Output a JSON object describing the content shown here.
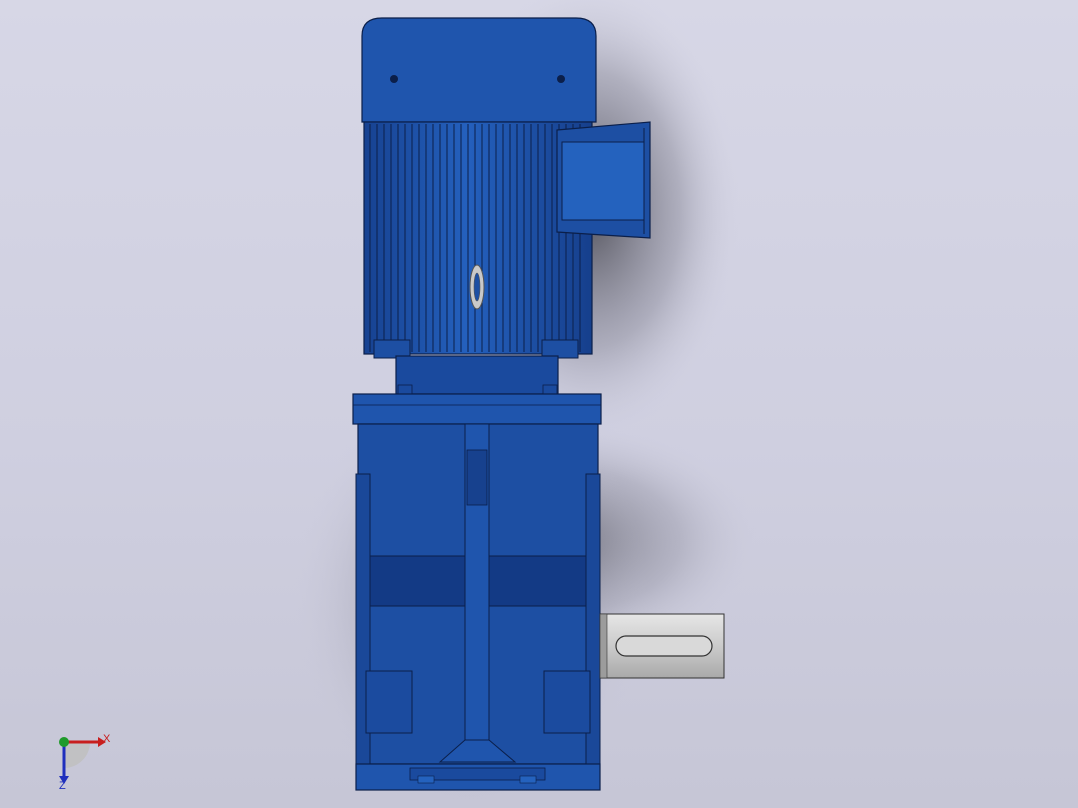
{
  "viewport": {
    "background_top": "#d7d7e6",
    "background_bottom": "#c6c6d6"
  },
  "model": {
    "body_color": "#1d4fa3",
    "body_dark": "#12357a",
    "body_light": "#2a63bd",
    "outline_color": "#0b1f4a",
    "shaft_color": "#d2d2d2"
  },
  "triad": {
    "x_label": "X",
    "z_label": "Z",
    "x_color": "#c81e1e",
    "y_color": "#1f9a2a",
    "z_color": "#1f2fbd"
  }
}
